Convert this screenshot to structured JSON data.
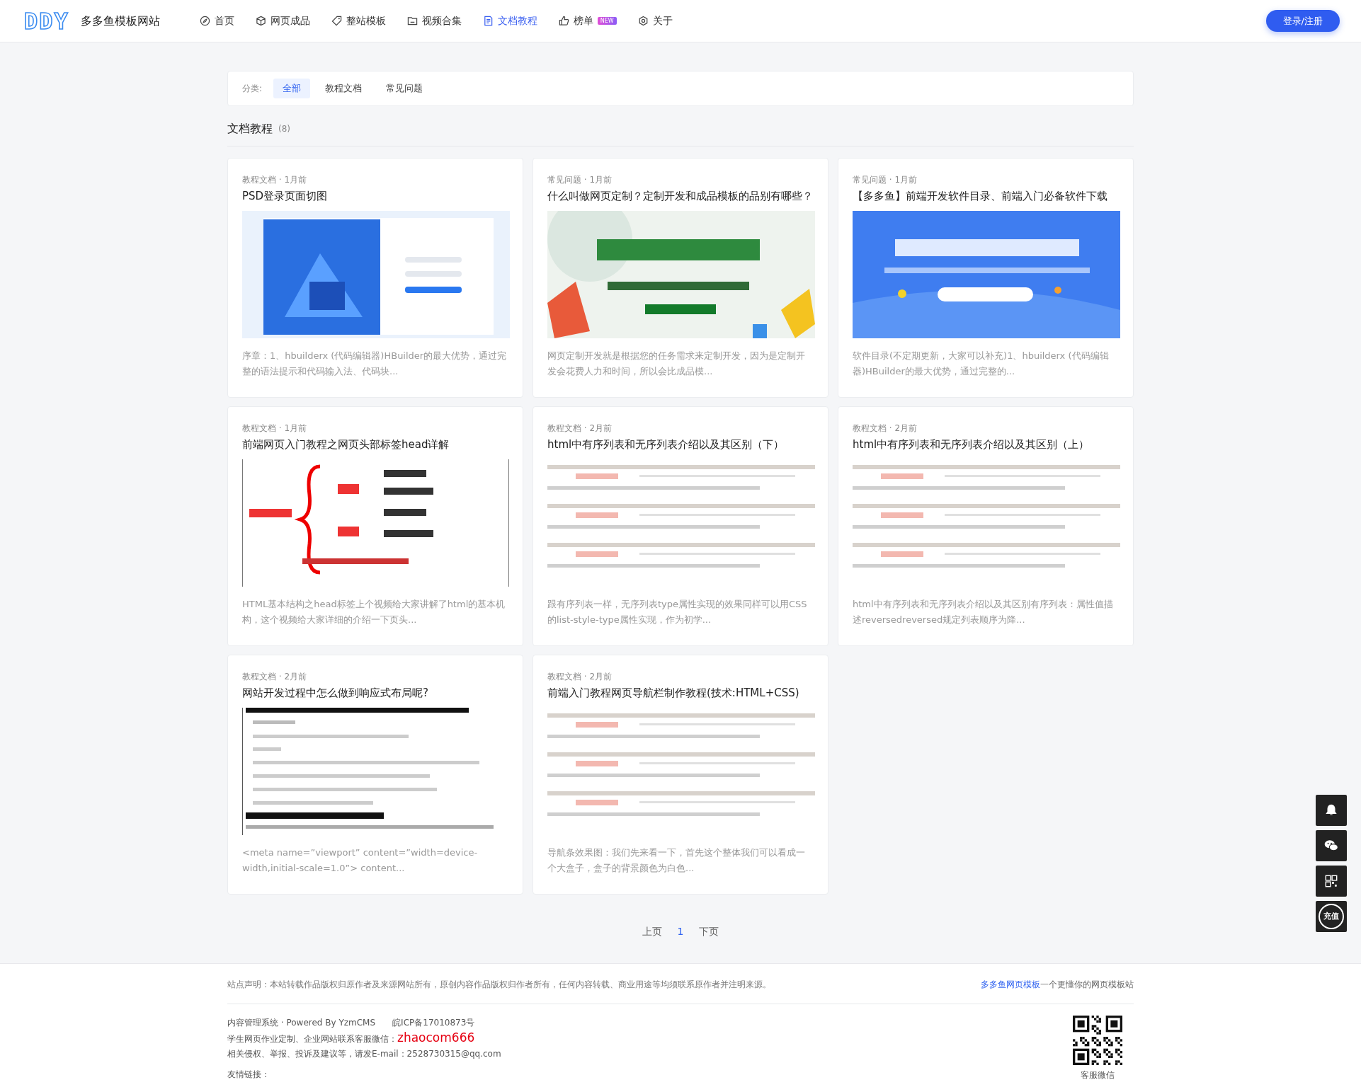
{
  "header": {
    "logo": "DDY",
    "site_name": "多多鱼模板网站",
    "nav": [
      {
        "label": "首页",
        "kind": "compass",
        "selected": false
      },
      {
        "label": "网页成品",
        "kind": "box",
        "selected": false
      },
      {
        "label": "整站模板",
        "kind": "tag",
        "selected": false
      },
      {
        "label": "视频合集",
        "kind": "folder",
        "selected": false
      },
      {
        "label": "文档教程",
        "kind": "doc",
        "selected": true
      },
      {
        "label": "榜单",
        "kind": "thumb",
        "selected": false,
        "badge": "NEW"
      },
      {
        "label": "关于",
        "kind": "gear",
        "selected": false
      }
    ],
    "login_button": "登录/注册"
  },
  "filter": {
    "label": "分类:",
    "options": [
      {
        "label": "全部",
        "selected": true
      },
      {
        "label": "教程文档",
        "selected": false
      },
      {
        "label": "常见问题",
        "selected": false
      }
    ]
  },
  "section": {
    "title": "文档教程",
    "count": "(8)"
  },
  "articles": [
    {
      "meta": "教程文档 · 1月前",
      "title": "PSD登录页面切图",
      "excerpt": "序章：1、hbuilderx (代码编辑器)HBuilder的最大优势，通过完整的语法提示和代码输入法、代码块..."
    },
    {
      "meta": "常见问题 · 1月前",
      "title": "什么叫做网页定制？定制开发和成品模板的品别有哪些？",
      "excerpt": "网页定制开发就是根据您的任务需求来定制开发，因为是定制开发会花费人力和时间，所以会比成品模..."
    },
    {
      "meta": "常见问题 · 1月前",
      "title": "【多多鱼】前端开发软件目录、前端入门必备软件下载",
      "excerpt": "软件目录(不定期更新，大家可以补充)1、hbuilderx (代码编辑器)HBuilder的最大优势，通过完整的..."
    },
    {
      "meta": "教程文档 · 1月前",
      "title": "前端网页入门教程之网页头部标签head详解",
      "excerpt": "HTML基本结构之head标签上个视频给大家讲解了html的基本机构，这个视频给大家详细的介绍一下页头..."
    },
    {
      "meta": "教程文档 · 2月前",
      "title": "html中有序列表和无序列表介绍以及其区别（下）",
      "excerpt": "跟有序列表一样，无序列表type属性实现的效果同样可以用CSS的list-style-type属性实现，作为初学..."
    },
    {
      "meta": "教程文档 · 2月前",
      "title": "html中有序列表和无序列表介绍以及其区别（上）",
      "excerpt": "html中有序列表和无序列表介绍以及其区别有序列表：属性值描述reversedreversed规定列表顺序为降..."
    },
    {
      "meta": "教程文档 · 2月前",
      "title": "网站开发过程中怎么做到响应式布局呢?",
      "excerpt": "<meta name=”viewport” content=”width=device-width,initial-scale=1.0”> content..."
    },
    {
      "meta": "教程文档 · 2月前",
      "title": "前端入门教程网页导航栏制作教程(技术:HTML+CSS)",
      "excerpt": "导航条效果图：我们先来看一下，首先这个整体我们可以看成一个大盒子，盒子的背景颜色为白色..."
    }
  ],
  "pagination": {
    "prev": "上页",
    "pages": [
      {
        "label": "1",
        "selected": true
      }
    ],
    "next": "下页"
  },
  "side_tools": [
    {
      "kind": "bell"
    },
    {
      "kind": "chat"
    },
    {
      "kind": "qr"
    },
    {
      "kind": "recharge",
      "label": "充值"
    }
  ],
  "footer": {
    "statement": "站点声明：本站转载作品版权归原作者及来源网站所有，原创内容作品版权归作者所有，任何内容转载、商业用途等均须联系原作者并注明来源。",
    "brand_link": "多多鱼网页模板",
    "brand_slogan": "一个更懂你的网页模板站",
    "cms": "内容管理系统 · Powered By YzmCMS",
    "icp": "皖ICP备17010873号",
    "contact_text": "学生网页作业定制、企业网站联系客服微信：",
    "wechat_id": "zhaocom666",
    "report": "相关侵权、举报、投诉及建议等，请发E-mail：2528730315@qq.com",
    "friend_links": "友情链接：",
    "qr_caption": "客服微信"
  }
}
